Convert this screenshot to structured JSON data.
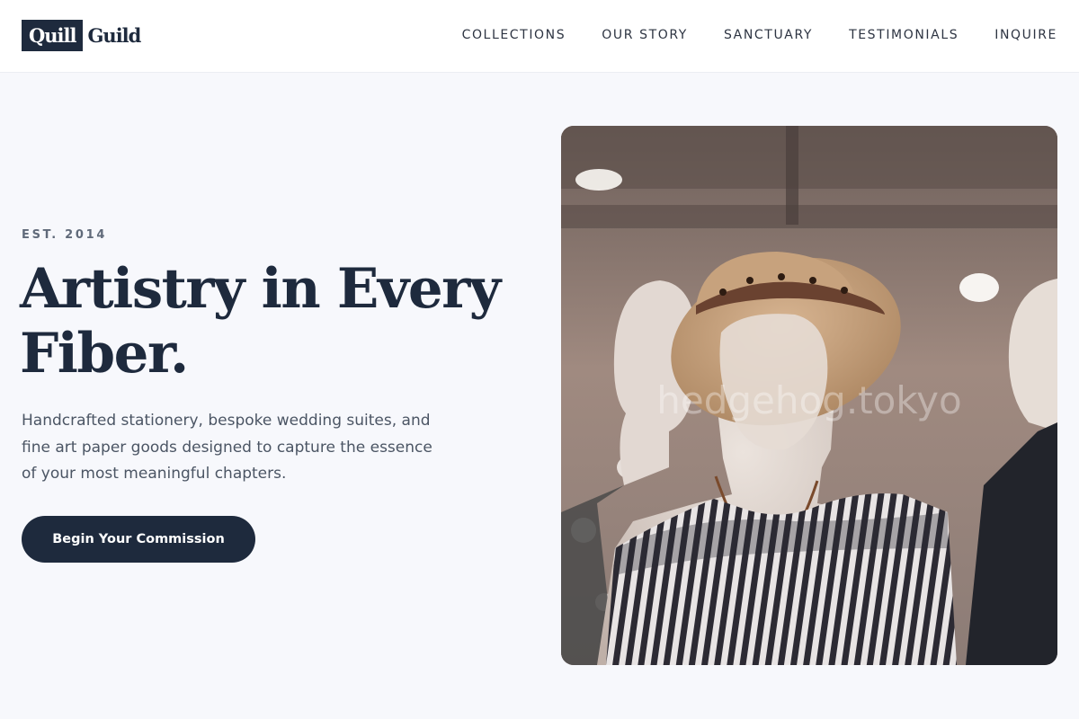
{
  "brand": {
    "logo_mark": "Quill",
    "logo_text": "Guild"
  },
  "nav": {
    "items": [
      "Collections",
      "Our Story",
      "Sanctuary",
      "Testimonials",
      "Inquire"
    ]
  },
  "hero": {
    "eyebrow": "EST. 2014",
    "headline": "Artistry in Every Fiber.",
    "lede": "Handcrafted stationery, bespoke wedding suites, and fine art paper goods designed to capture the essence of your most meaningful chapters.",
    "cta_label": "Begin Your Commission"
  },
  "image": {
    "watermark": "hedgehog.tokyo"
  },
  "colors": {
    "primary": "#1e2a3d",
    "background": "#f7f8fc",
    "muted_text": "#4b5564"
  }
}
